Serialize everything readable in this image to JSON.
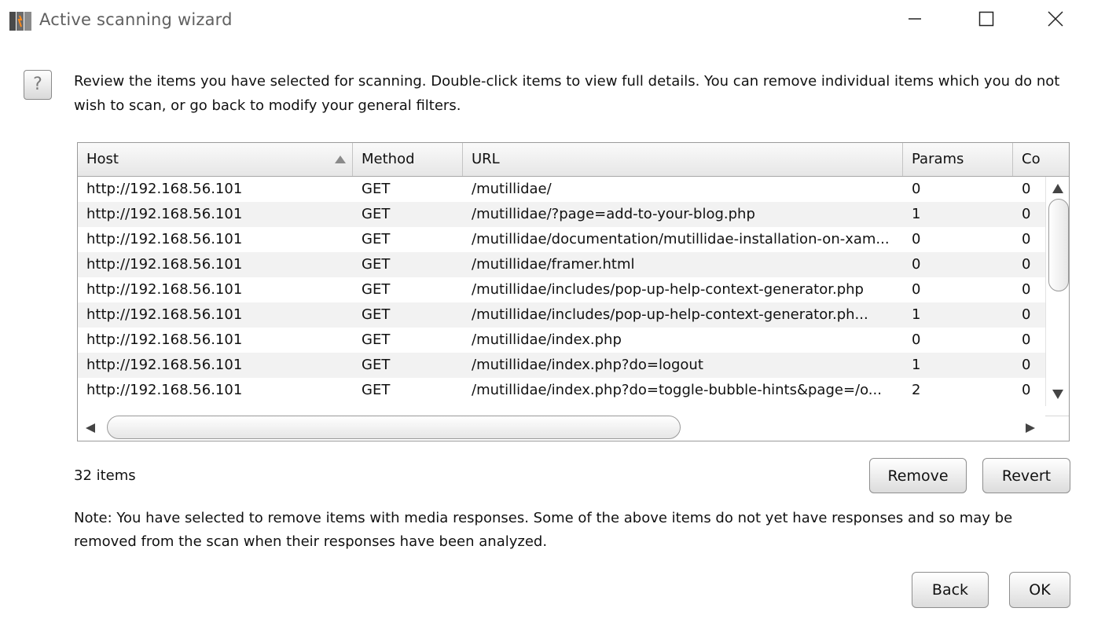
{
  "window": {
    "title": "Active scanning wizard",
    "icon": "burp-suite-app-icon",
    "controls": [
      "minimize-icon",
      "maximize-icon",
      "close-icon"
    ]
  },
  "help_icon": {
    "glyph": "?",
    "name": "help-icon"
  },
  "description": "Review the items you have selected for scanning. Double-click items to view full details. You can remove individual items which you do not wish to scan, or go back to modify your general filters.",
  "table": {
    "columns": [
      "Host",
      "Method",
      "URL",
      "Params",
      "Co"
    ],
    "sort_column": "Host",
    "sort_direction": "ascending",
    "rows": [
      {
        "host": "http://192.168.56.101",
        "method": "GET",
        "url": "/mutillidae/",
        "params": "0",
        "co": "0"
      },
      {
        "host": "http://192.168.56.101",
        "method": "GET",
        "url": "/mutillidae/?page=add-to-your-blog.php",
        "params": "1",
        "co": "0"
      },
      {
        "host": "http://192.168.56.101",
        "method": "GET",
        "url": "/mutillidae/documentation/mutillidae-installation-on-xam...",
        "params": "0",
        "co": "0"
      },
      {
        "host": "http://192.168.56.101",
        "method": "GET",
        "url": "/mutillidae/framer.html",
        "params": "0",
        "co": "0"
      },
      {
        "host": "http://192.168.56.101",
        "method": "GET",
        "url": "/mutillidae/includes/pop-up-help-context-generator.php",
        "params": "0",
        "co": "0"
      },
      {
        "host": "http://192.168.56.101",
        "method": "GET",
        "url": "/mutillidae/includes/pop-up-help-context-generator.ph...",
        "params": "1",
        "co": "0"
      },
      {
        "host": "http://192.168.56.101",
        "method": "GET",
        "url": "/mutillidae/index.php",
        "params": "0",
        "co": "0"
      },
      {
        "host": "http://192.168.56.101",
        "method": "GET",
        "url": "/mutillidae/index.php?do=logout",
        "params": "1",
        "co": "0"
      },
      {
        "host": "http://192.168.56.101",
        "method": "GET",
        "url": "/mutillidae/index.php?do=toggle-bubble-hints&page=/o...",
        "params": "2",
        "co": "0"
      }
    ]
  },
  "item_count": "32 items",
  "buttons": {
    "remove": "Remove",
    "revert": "Revert",
    "back": "Back",
    "ok": "OK"
  },
  "note": "Note: You have selected to remove items with media responses. Some of the above items do not yet have responses and so may be removed from the scan when their responses have been analyzed.",
  "colors": {
    "row_alt": "#f2f2f2",
    "header_bg": "#e6e6e6",
    "border": "#9a9a9a"
  }
}
